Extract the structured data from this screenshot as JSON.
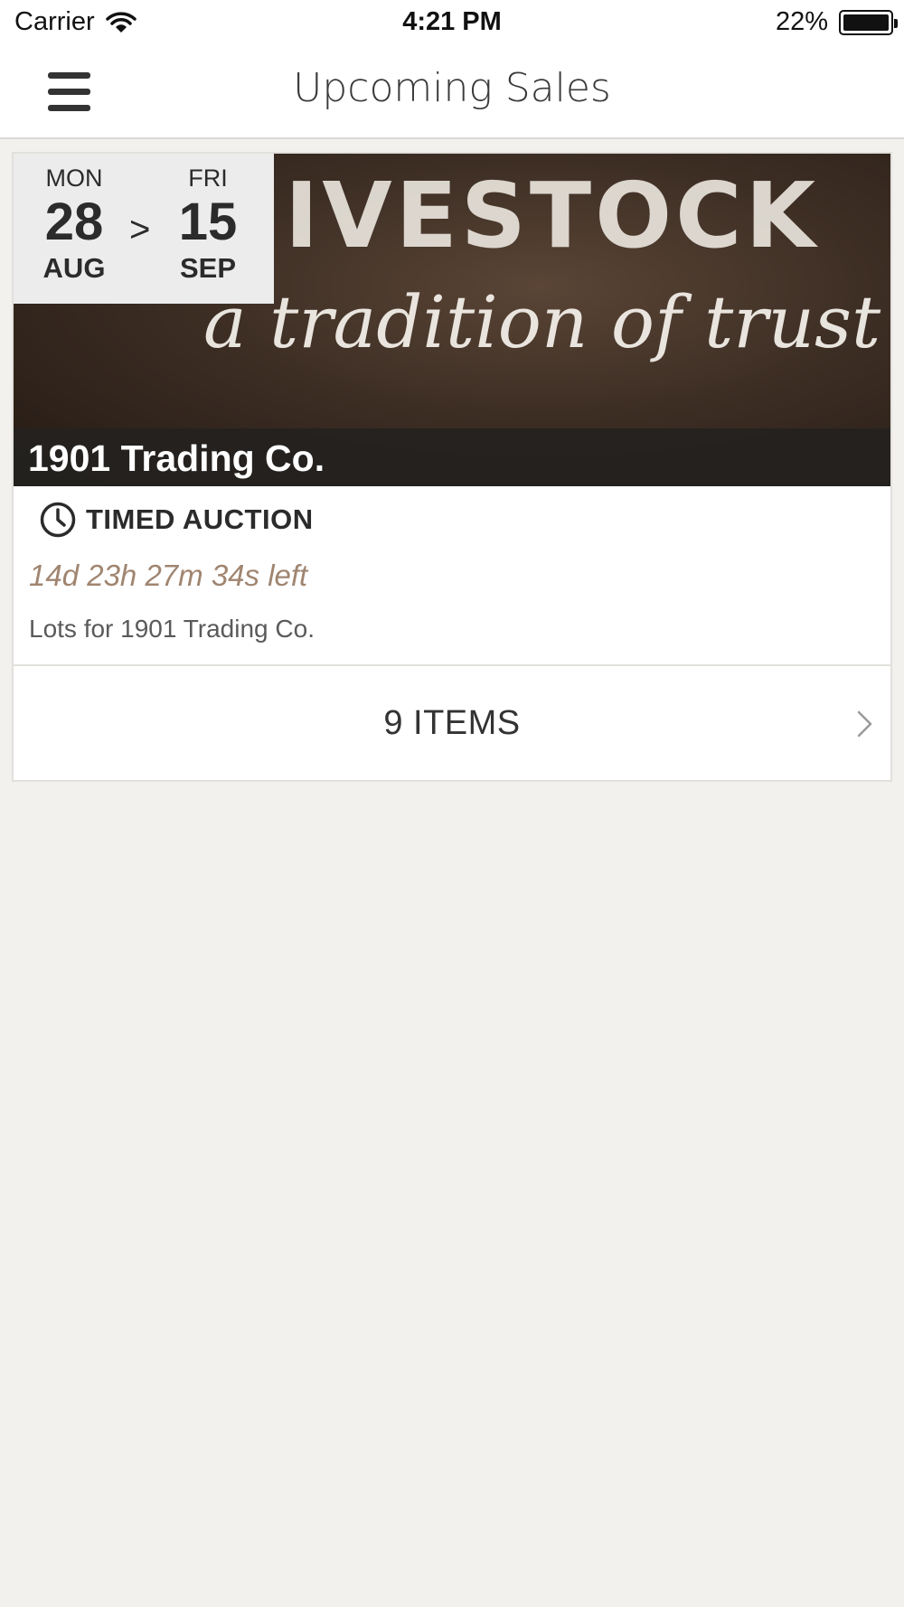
{
  "status_bar": {
    "carrier": "Carrier",
    "wifi_icon": "wifi-icon",
    "time": "4:21 PM",
    "battery_percent": "22%",
    "battery_level": 0.22,
    "battery_icon": "battery-icon"
  },
  "nav": {
    "title": "Upcoming Sales",
    "menu_icon": "hamburger-menu-icon"
  },
  "sale": {
    "banner": {
      "headline": "IVESTOCK",
      "tagline": "a tradition of trust"
    },
    "start": {
      "dow": "MON",
      "day": "28",
      "month": "AUG"
    },
    "arrow": ">",
    "end": {
      "dow": "FRI",
      "day": "15",
      "month": "SEP"
    },
    "seller": "1901 Trading Co.",
    "auction_type": "TIMED AUCTION",
    "auction_icon": "clock-icon",
    "time_left": "14d 23h 27m 34s left",
    "description": "Lots for 1901 Trading Co.",
    "items_label": "9 ITEMS",
    "chevron_icon": "chevron-right-icon"
  },
  "colors": {
    "page_background": "#f3f1ee",
    "time_left": "#a08570",
    "seller_strip": "#23211f",
    "date_box": "#ececec"
  }
}
